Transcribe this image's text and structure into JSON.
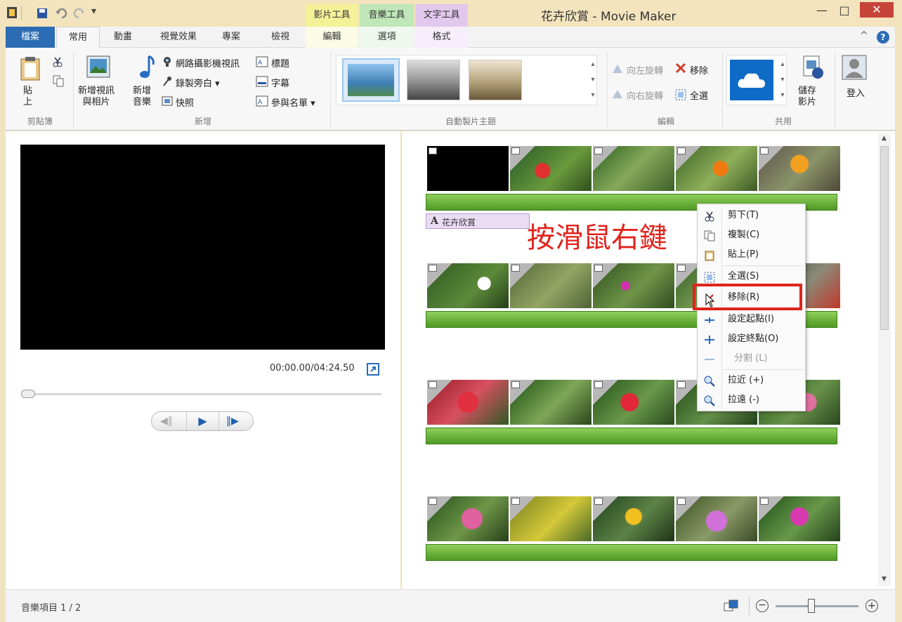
{
  "window": {
    "title": "花卉欣賞 - Movie Maker",
    "contextual_tabs": [
      "影片工具",
      "音樂工具",
      "文字工具"
    ],
    "contextual_subtabs": [
      "編輯",
      "選項",
      "格式"
    ]
  },
  "tabs": [
    "檔案",
    "常用",
    "動畫",
    "視覺效果",
    "專案",
    "檢視"
  ],
  "ribbon": {
    "paste_label": "貼\n上",
    "add_media": "新增視訊\n與相片",
    "add_music": "新增\n音樂",
    "webcam": "網路攝影機視訊",
    "narration": "錄製旁白",
    "snapshot": "快照",
    "title_btn": "標題",
    "caption_btn": "字幕",
    "credits_btn": "參與名單",
    "rotate_left": "向左旋轉",
    "rotate_right": "向右旋轉",
    "remove": "移除",
    "select_all": "全選",
    "save_movie": "儲存\n影片",
    "sign_in": "登入",
    "groups": {
      "clipboard": "剪貼簿",
      "add": "新增",
      "themes": "自動製片主題",
      "editing": "編輯",
      "share": "共用"
    }
  },
  "preview": {
    "timecode": "00:00.00/04:24.50",
    "progress": 0.0
  },
  "storyboard": {
    "text_overlay": "花卉欣賞",
    "annotation": "按滑鼠右鍵"
  },
  "context_menu": {
    "items": [
      {
        "label": "剪下(T)",
        "icon": "scissors-icon"
      },
      {
        "label": "複製(C)",
        "icon": "copy-icon"
      },
      {
        "label": "貼上(P)",
        "icon": "paste-icon"
      },
      {
        "label": "全選(S)",
        "icon": "select-all-icon"
      },
      {
        "label": "移除(R)",
        "icon": "remove-x-icon",
        "highlighted": true
      },
      {
        "label": "設定起點(I)",
        "icon": "set-start-icon"
      },
      {
        "label": "設定終點(O)",
        "icon": "set-end-icon"
      },
      {
        "label": "分割 (L)",
        "icon": "split-icon",
        "disabled": true
      },
      {
        "label": "拉近 (+)",
        "icon": "zoom-in-icon"
      },
      {
        "label": "拉遠 (-)",
        "icon": "zoom-out-icon"
      }
    ]
  },
  "status": {
    "text": "音樂項目 1 / 2",
    "zoom_level": 0.45
  },
  "colors": {
    "file_tab": "#2b6cb5",
    "highlight_box": "#e0231c",
    "audio_track": "#5fa832",
    "overlay_text": "#e0231c"
  }
}
